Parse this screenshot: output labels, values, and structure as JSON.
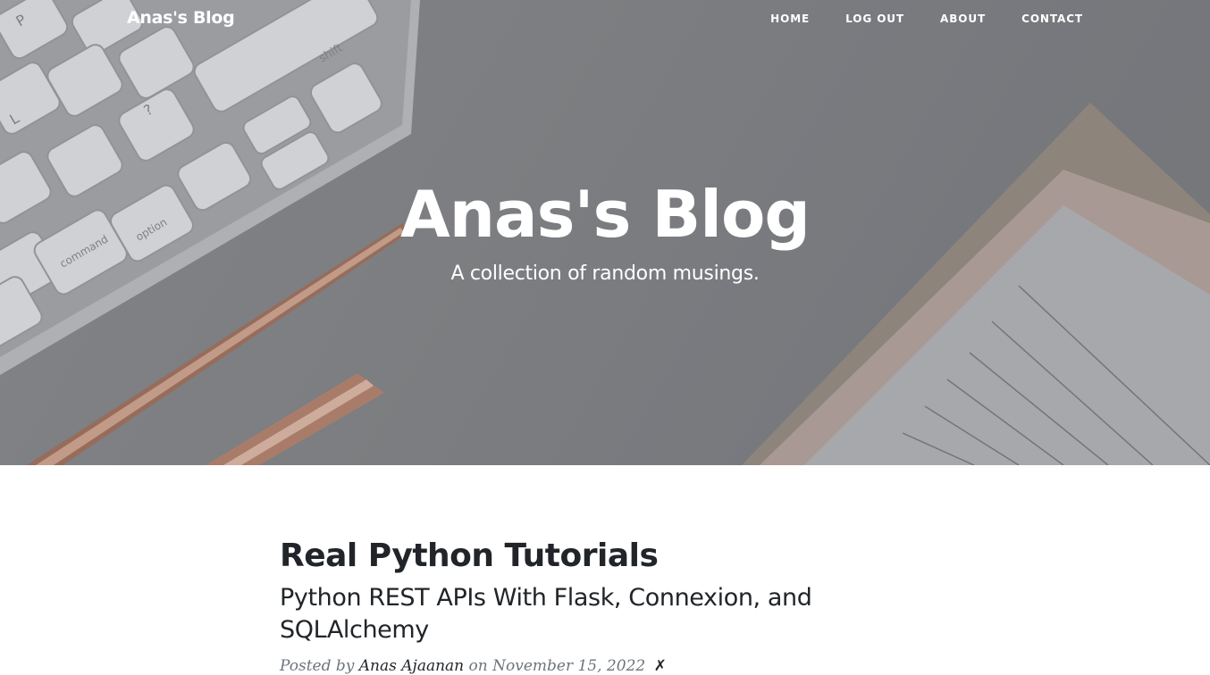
{
  "nav": {
    "brand": "Anas's Blog",
    "links": [
      "Home",
      "Log Out",
      "About",
      "Contact"
    ]
  },
  "header": {
    "title": "Anas's Blog",
    "subtitle": "A collection of random musings."
  },
  "posts": [
    {
      "title": "Real Python Tutorials",
      "subtitle": "Python REST APIs With Flask, Connexion, and SQLAlchemy",
      "posted_by_label": "Posted by",
      "author": "Anas Ajaanan",
      "on_label": "on",
      "date": "November 15, 2022",
      "delete_symbol": "✗"
    }
  ],
  "colors": {
    "text_dark": "#212529",
    "meta_gray": "#6c757d",
    "hero_tint": "#86878b"
  }
}
